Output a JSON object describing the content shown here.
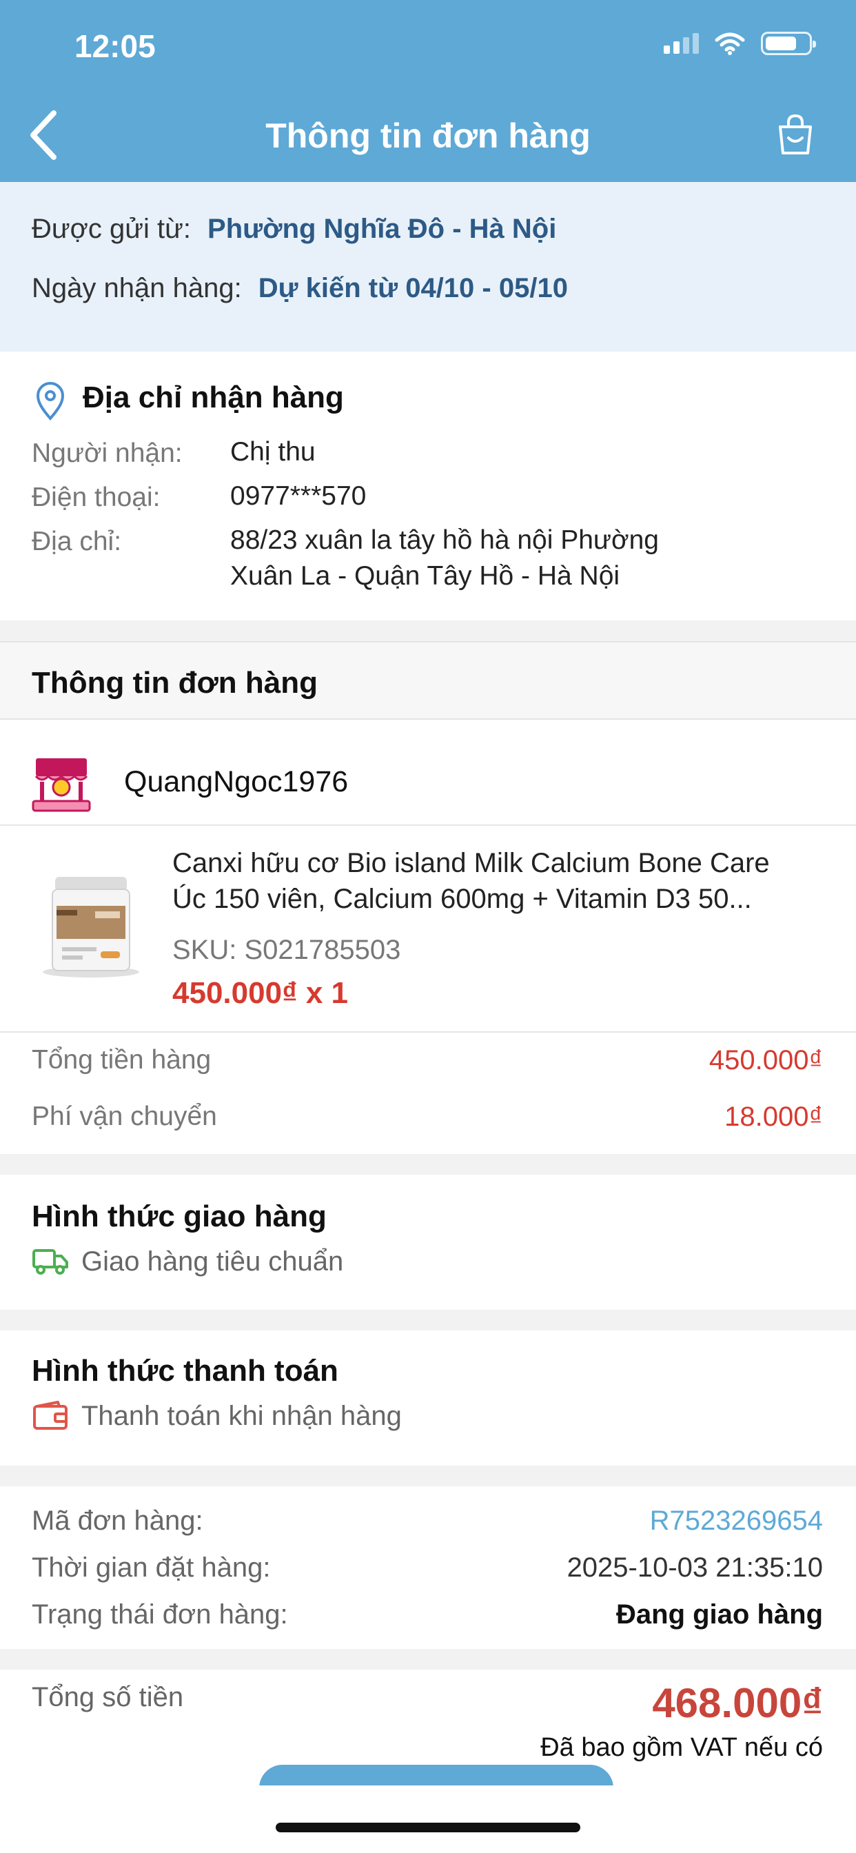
{
  "status_bar": {
    "time": "12:05"
  },
  "nav": {
    "title": "Thông tin đơn hàng"
  },
  "shipping": {
    "from_label": "Được gửi từ:",
    "from_value": "Phường Nghĩa Đô - Hà Nội",
    "date_label": "Ngày nhận hàng:",
    "date_value": "Dự kiến từ 04/10 - 05/10"
  },
  "address": {
    "title": "Địa chỉ nhận hàng",
    "recipient_label": "Người nhận:",
    "recipient_value": "Chị thu",
    "phone_label": "Điện thoại:",
    "phone_value": "0977***570",
    "addr_label": "Địa chỉ:",
    "addr_line1": "88/23 xuân la tây hồ hà nội Phường",
    "addr_line2": "Xuân La - Quận Tây Hồ - Hà Nội"
  },
  "order_section": {
    "title": "Thông tin đơn hàng"
  },
  "shop": {
    "name": "QuangNgoc1976"
  },
  "product": {
    "name_line1": "Canxi hữu cơ Bio island Milk Calcium Bone Care",
    "name_line2": "Úc 150 viên, Calcium 600mg + Vitamin D3 50...",
    "sku": "SKU: S021785503",
    "price_qty": "450.000₫ x 1"
  },
  "summary": {
    "subtotal_label": "Tổng tiền hàng",
    "subtotal_value": "450.000₫",
    "shipping_label": "Phí vận chuyển",
    "shipping_value": "18.000₫"
  },
  "delivery": {
    "title": "Hình thức giao hàng",
    "method": "Giao hàng tiêu chuẩn"
  },
  "payment": {
    "title": "Hình thức thanh toán",
    "method": "Thanh toán khi nhận hàng"
  },
  "order_info": {
    "code_label": "Mã đơn hàng:",
    "code_value": "R7523269654",
    "time_label": "Thời gian đặt hàng:",
    "time_value": "2025-10-03 21:35:10",
    "status_label": "Trạng thái đơn hàng:",
    "status_value": "Đang giao hàng"
  },
  "total": {
    "label": "Tổng số tiền",
    "value": "468.000₫",
    "note": "Đã bao gồm VAT nếu có"
  },
  "colors": {
    "header": "#5ea9d6",
    "price": "#d63a2f",
    "link": "#5ea9d6",
    "ship_box": "#e8f1f9"
  },
  "icons": [
    "back-chevron-icon",
    "shopping-bag-icon",
    "location-pin-icon",
    "shop-stall-icon",
    "truck-icon",
    "wallet-icon",
    "wifi-icon",
    "signal-icon",
    "battery-icon"
  ]
}
